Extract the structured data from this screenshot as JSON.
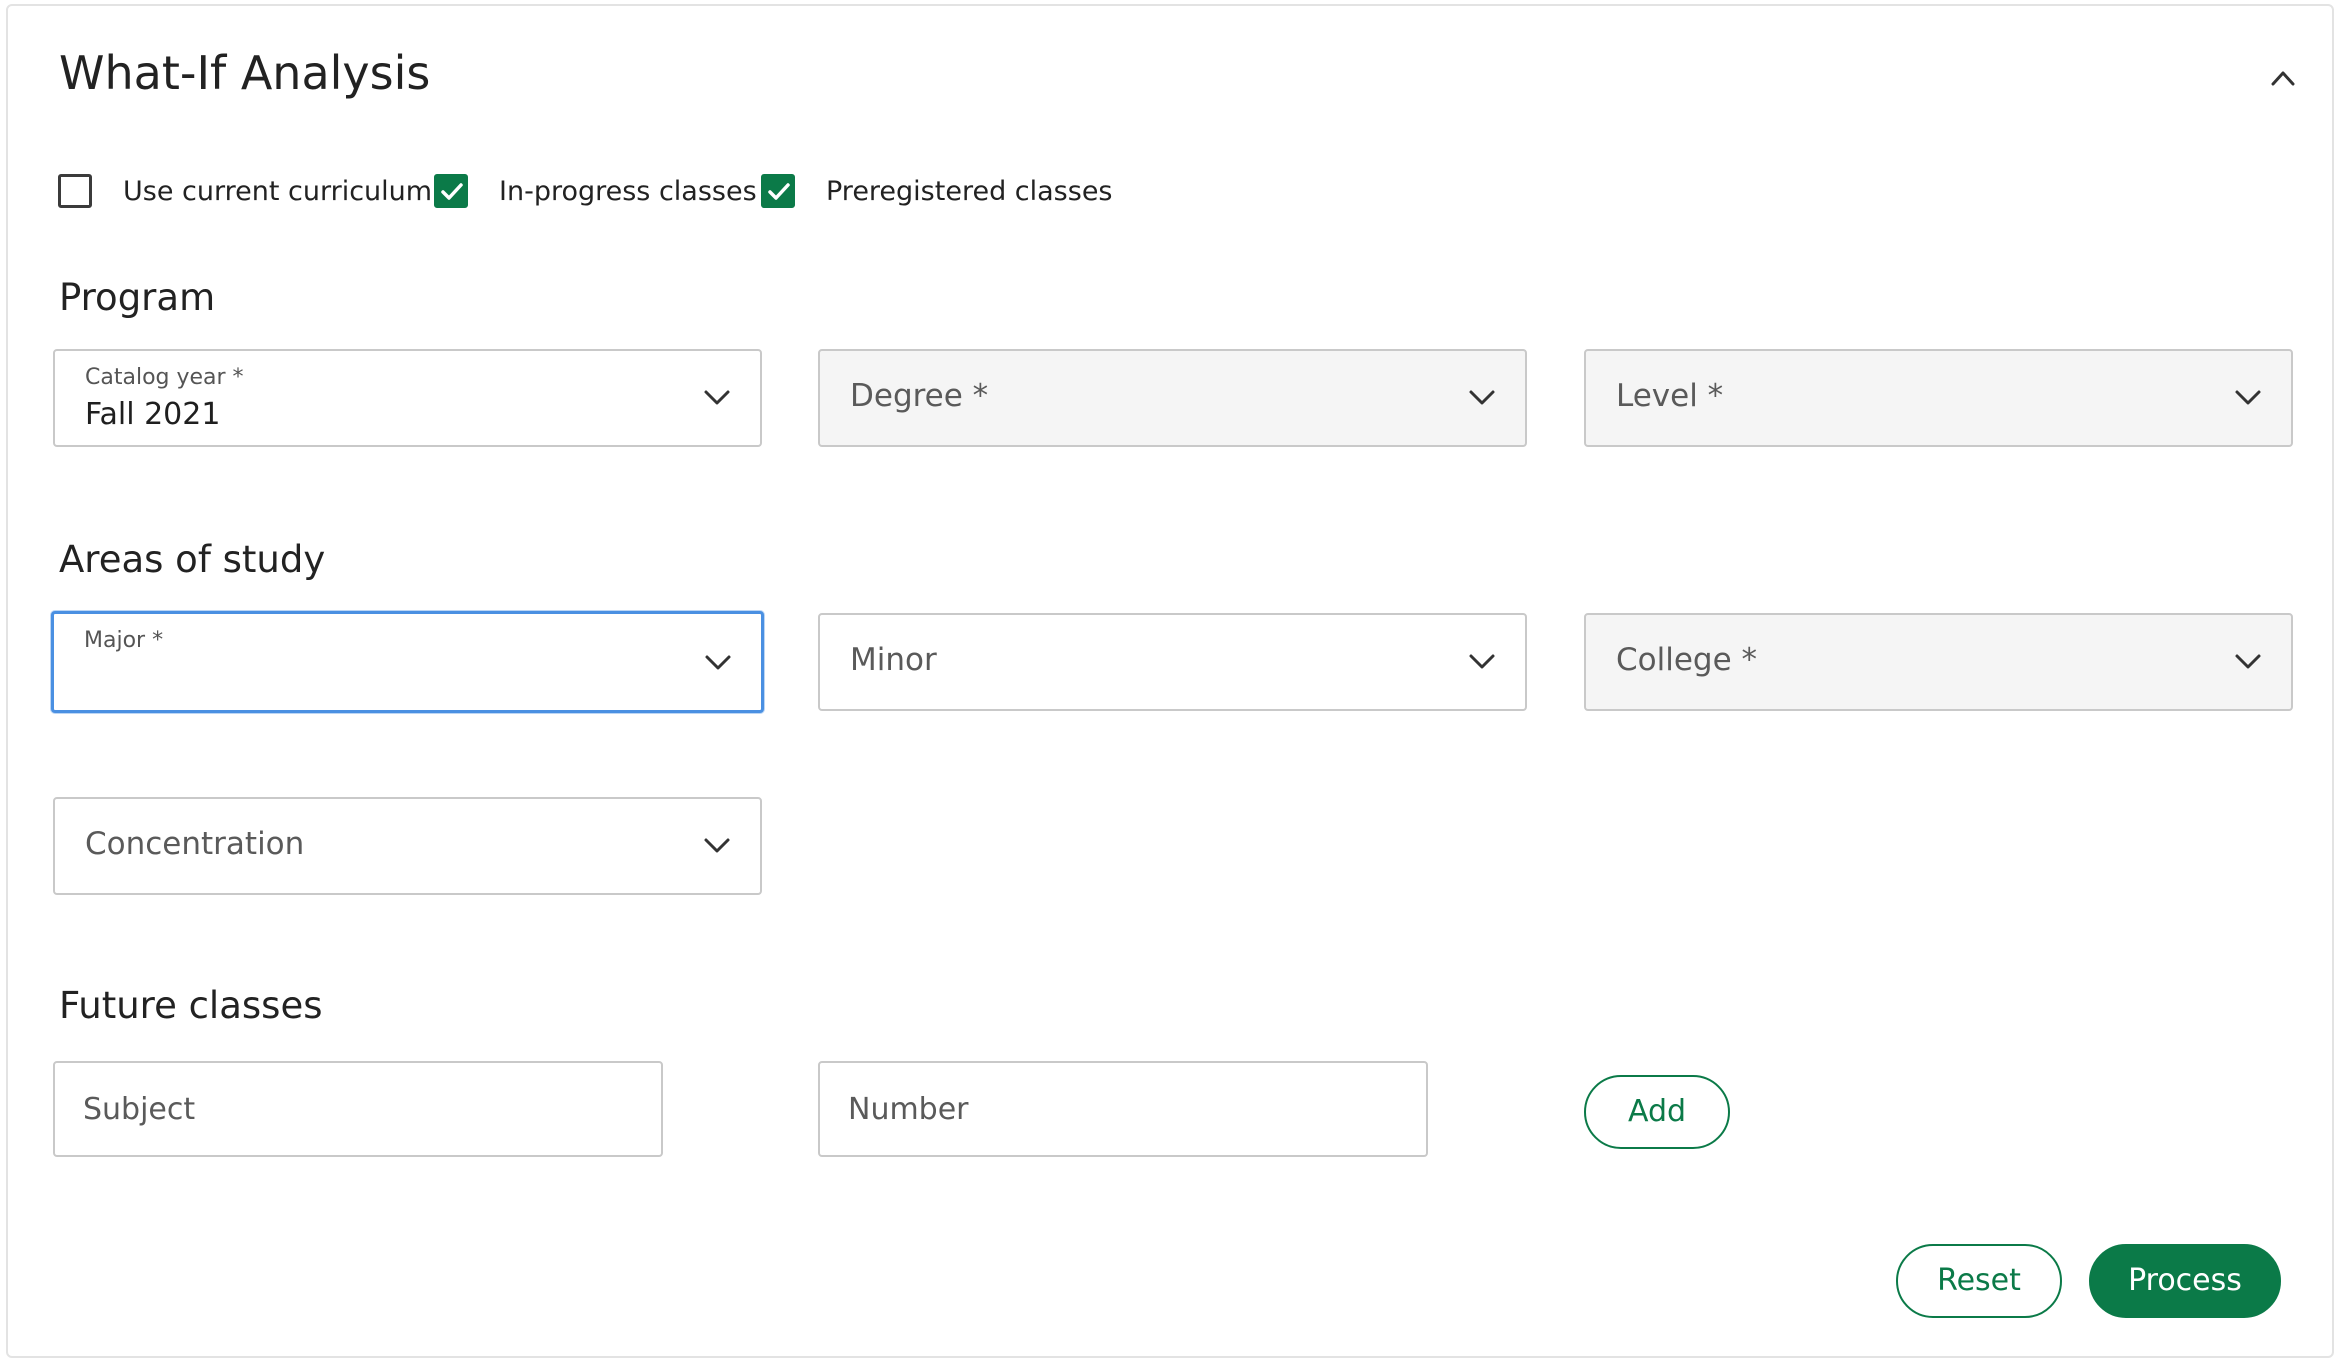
{
  "panel": {
    "title": "What-If Analysis",
    "collapse_icon": "chevron-up-icon"
  },
  "options": [
    {
      "label": "Use current curriculum",
      "checked": false
    },
    {
      "label": "In-progress classes",
      "checked": true
    },
    {
      "label": "Preregistered classes",
      "checked": true
    }
  ],
  "program": {
    "heading": "Program",
    "catalog_year": {
      "label": "Catalog year *",
      "value": "Fall 2021"
    },
    "degree": {
      "placeholder": "Degree *"
    },
    "level": {
      "placeholder": "Level *"
    }
  },
  "areas": {
    "heading": "Areas of study",
    "major": {
      "label": "Major *",
      "value": ""
    },
    "minor": {
      "placeholder": "Minor"
    },
    "college": {
      "placeholder": "College *"
    },
    "concentration": {
      "placeholder": "Concentration"
    }
  },
  "future": {
    "heading": "Future classes",
    "subject": {
      "placeholder": "Subject",
      "value": ""
    },
    "number": {
      "placeholder": "Number",
      "value": ""
    },
    "add_label": "Add"
  },
  "actions": {
    "reset_label": "Reset",
    "process_label": "Process"
  },
  "colors": {
    "accent": "#0b7a48",
    "focus": "#4a90e2",
    "border": "#c9c9c9",
    "disabled_bg": "#f5f5f5"
  }
}
